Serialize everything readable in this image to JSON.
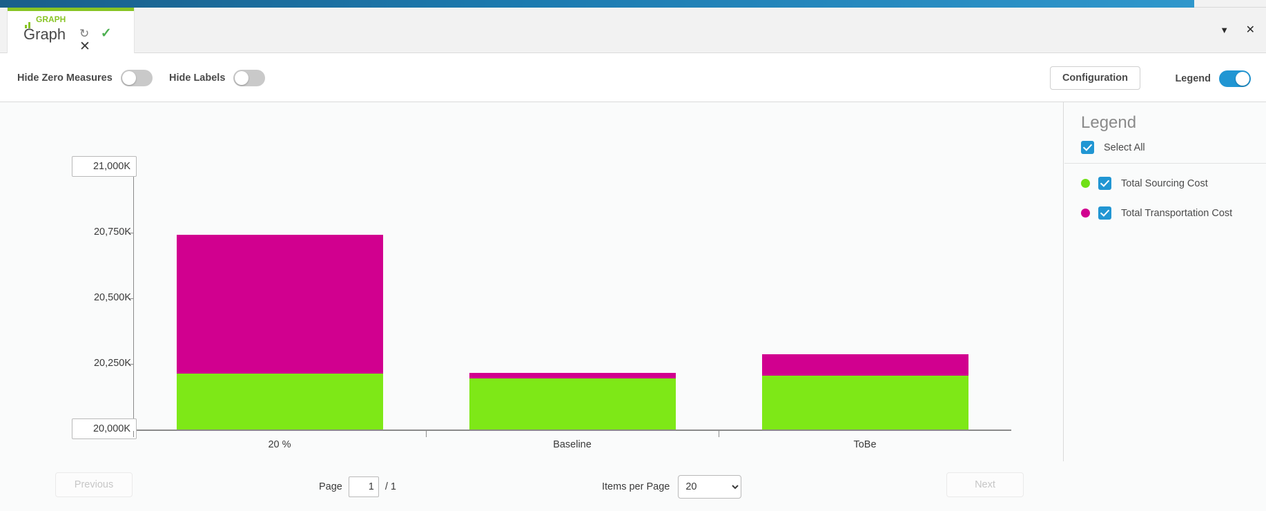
{
  "window": {
    "tab_kicker": "GRAPH",
    "tab_title": "Graph",
    "icon_refresh": "↻",
    "icon_check": "✓",
    "icon_close": "✕",
    "icon_funnel": "▼",
    "icon_window_close": "✕"
  },
  "toolbar": {
    "hide_zero_measures_label": "Hide Zero Measures",
    "hide_zero_measures_on": false,
    "hide_labels_label": "Hide Labels",
    "hide_labels_on": false,
    "configuration_label": "Configuration",
    "legend_label": "Legend",
    "legend_on": true
  },
  "legend": {
    "title": "Legend",
    "select_all_label": "Select All",
    "items": [
      {
        "label": "Total Sourcing Cost",
        "color": "#6fe016",
        "checked": true
      },
      {
        "label": "Total Transportation Cost",
        "color": "#d1008f",
        "checked": true
      }
    ]
  },
  "footer": {
    "previous_label": "Previous",
    "next_label": "Next",
    "page_label": "Page",
    "page_value": "1",
    "page_total": "/ 1",
    "items_per_page_label": "Items per Page",
    "items_per_page_value": "20",
    "items_per_page_options": [
      "20"
    ]
  },
  "chart_data": {
    "type": "bar",
    "title": "",
    "xlabel": "",
    "ylabel": "",
    "stacked": true,
    "grid": false,
    "legend_position": "right",
    "categories": [
      "20 %",
      "Baseline",
      "ToBe"
    ],
    "ylim": [
      20000,
      21000
    ],
    "yticks": [
      20000,
      20250,
      20500,
      20750,
      21000
    ],
    "ytick_labels": [
      "20,000K",
      "20,250K",
      "20,500K",
      "20,750K",
      "21,000K"
    ],
    "series": [
      {
        "name": "Total Sourcing Cost",
        "color": "#7ee817",
        "values": [
          20214,
          20196,
          20204
        ]
      },
      {
        "name": "Total Transportation Cost",
        "color": "#d1008f",
        "values": [
          528,
          19,
          82
        ]
      }
    ],
    "stack_tops": [
      20742,
      20215,
      20286
    ]
  }
}
